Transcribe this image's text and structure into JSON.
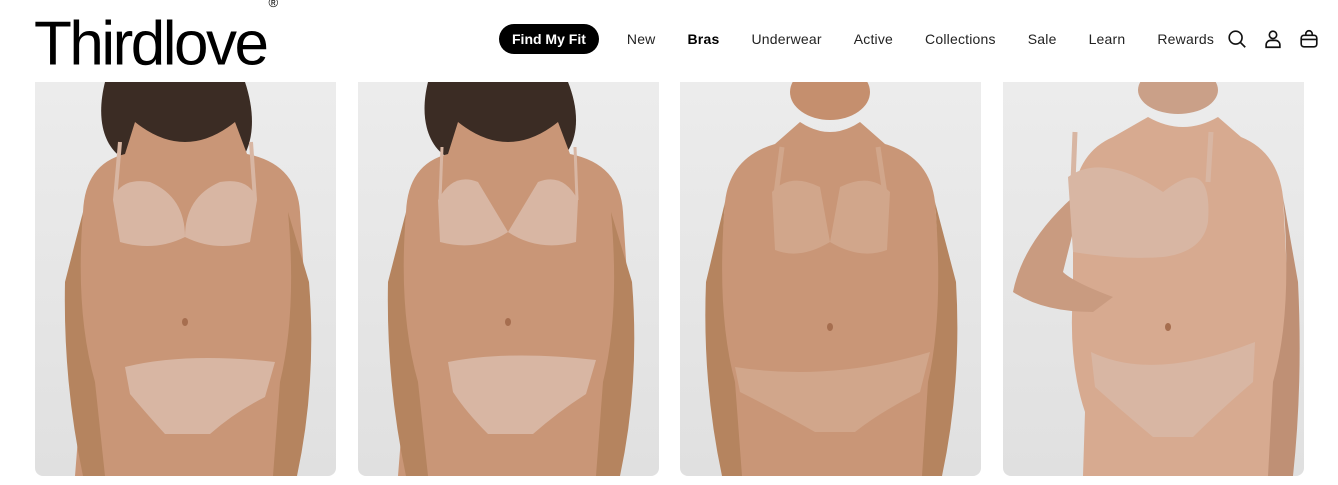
{
  "brand": {
    "name": "Thirdlove",
    "trademark": "®"
  },
  "nav": {
    "cta": "Find My Fit",
    "items": [
      "New",
      "Bras",
      "Underwear",
      "Active",
      "Collections",
      "Sale",
      "Learn",
      "Rewards"
    ]
  },
  "icons": [
    "search-icon",
    "account-icon",
    "cart-icon"
  ],
  "colors": {
    "cta_bg": "#000000",
    "cta_text": "#ffffff",
    "card_bg": "#e6e6e6",
    "product_tone": "#d8b6a3",
    "skin": "#c99677"
  },
  "products": [
    {
      "name": "product-card-1"
    },
    {
      "name": "product-card-2"
    },
    {
      "name": "product-card-3"
    },
    {
      "name": "product-card-4"
    }
  ]
}
